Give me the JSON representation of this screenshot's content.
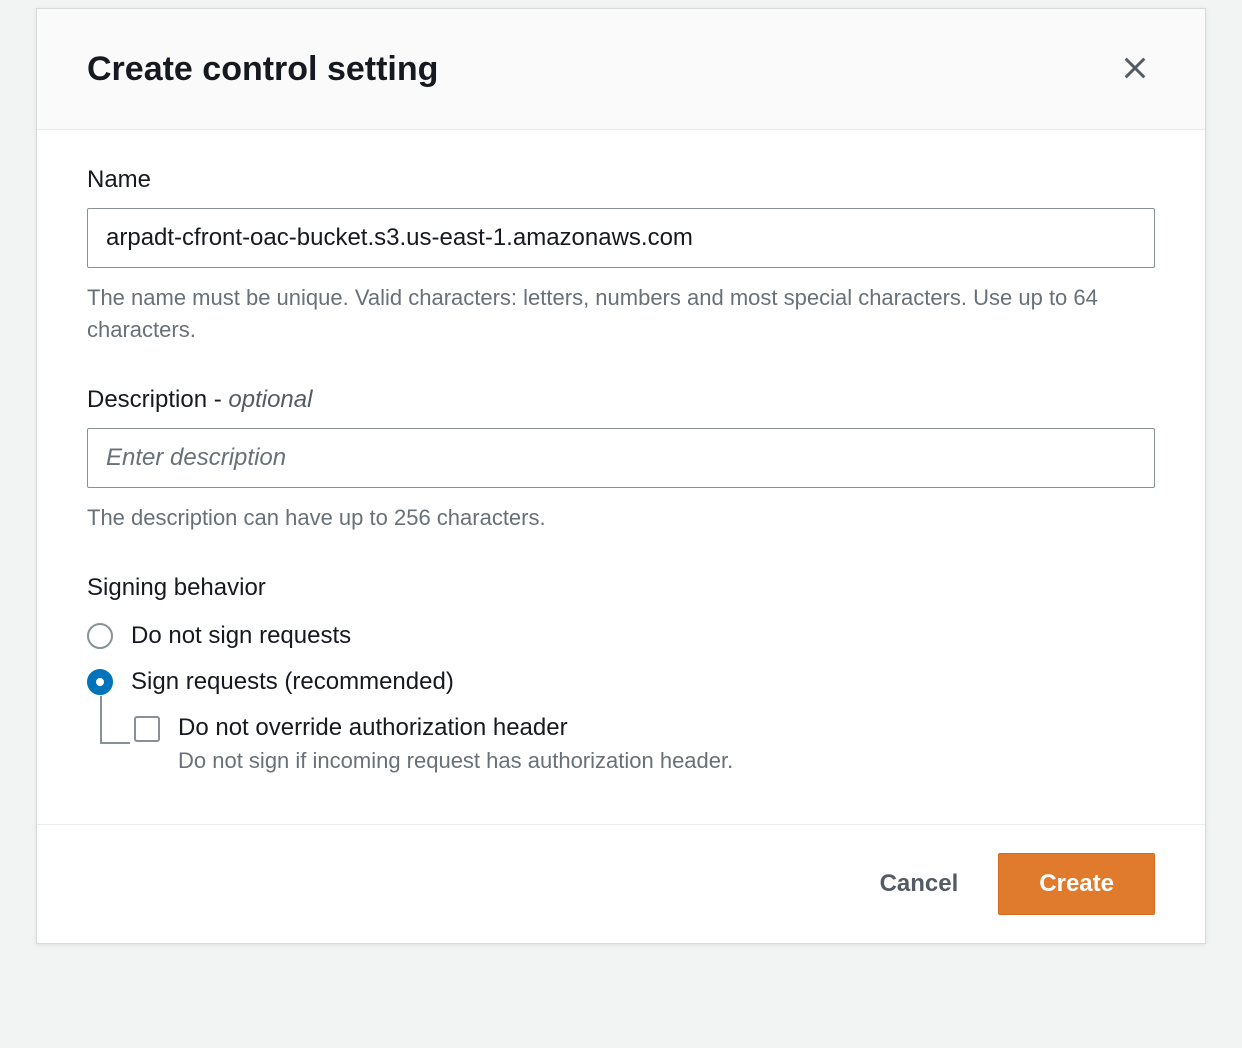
{
  "modal": {
    "title": "Create control setting",
    "fields": {
      "name": {
        "label": "Name",
        "value": "arpadt-cfront-oac-bucket.s3.us-east-1.amazonaws.com",
        "help": "The name must be unique. Valid characters: letters, numbers and most special characters. Use up to 64 characters."
      },
      "description": {
        "label": "Description - ",
        "optional": "optional",
        "placeholder": "Enter description",
        "value": "",
        "help": "The description can have up to 256 characters."
      },
      "signing": {
        "label": "Signing behavior",
        "options": {
          "doNotSign": "Do not sign requests",
          "sign": "Sign requests (recommended)"
        },
        "selected": "sign",
        "override": {
          "label": "Do not override authorization header",
          "help": "Do not sign if incoming request has authorization header.",
          "checked": false
        }
      }
    },
    "footer": {
      "cancel": "Cancel",
      "create": "Create"
    }
  }
}
